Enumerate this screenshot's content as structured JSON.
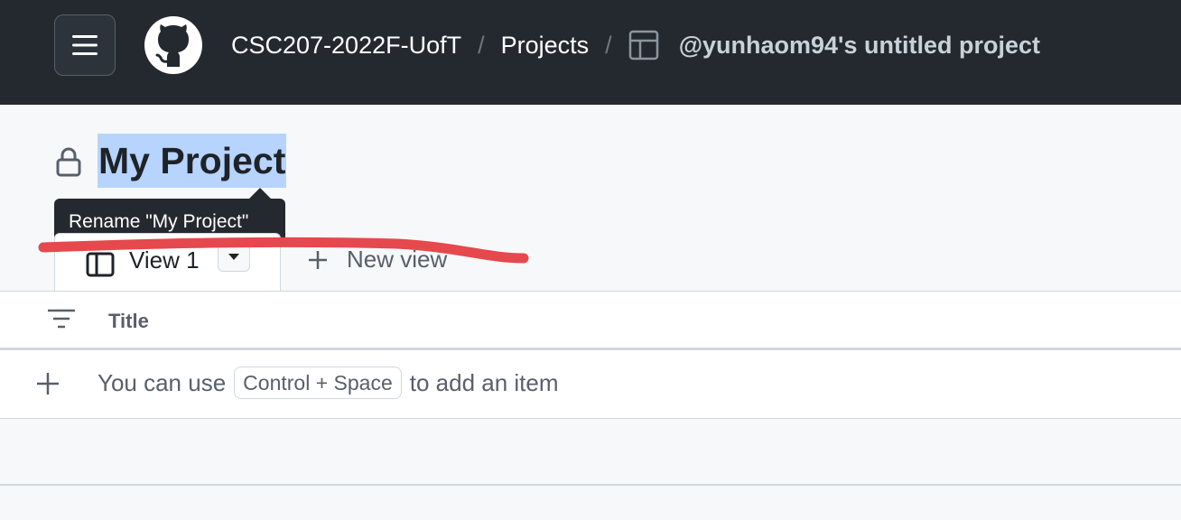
{
  "header": {
    "org": "CSC207-2022F-UofT",
    "projects": "Projects",
    "separator": "/",
    "current_project": "@yunhaom94's untitled project"
  },
  "project": {
    "title": "My Project",
    "tooltip": "Rename \"My Project\""
  },
  "views": {
    "active_tab": "View 1",
    "new_view": "New view"
  },
  "table": {
    "column_title": "Title",
    "add_hint_prefix": "You can use",
    "shortcut": "Control + Space",
    "add_hint_suffix": "to add an item"
  },
  "colors": {
    "header_bg": "#24292f",
    "selection": "#b6d4fe",
    "annotation_red": "#e5484d"
  }
}
